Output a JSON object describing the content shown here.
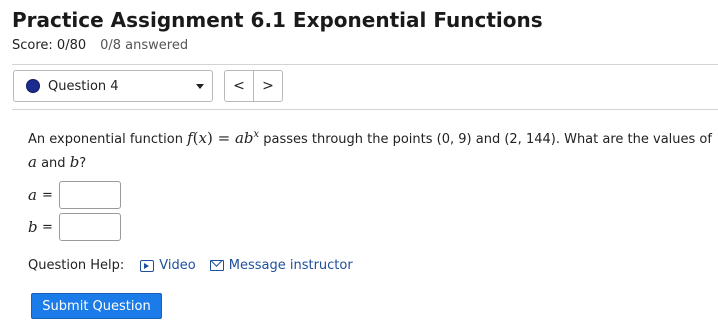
{
  "assignment": {
    "title": "Practice Assignment 6.1 Exponential Functions",
    "score": "Score: 0/80",
    "answered": "0/8 answered"
  },
  "question_nav": {
    "selected": "Question 4",
    "prev_symbol": "<",
    "next_symbol": ">"
  },
  "question": {
    "intro": "An exponential function ",
    "func_f": "f",
    "func_x": "x",
    "func_eq": " = ",
    "func_ab": "ab",
    "func_exp": "x",
    "mid": " passes through the points (0, 9) and (2, 144). What are the values of ",
    "var_a": "a",
    "and_text": " and ",
    "var_b": "b",
    "end": "?"
  },
  "answers": {
    "a_label": "a",
    "b_label": "b",
    "eq": "=",
    "a_value": "",
    "b_value": ""
  },
  "help": {
    "label": "Question Help:",
    "video": "Video",
    "message": "Message instructor"
  },
  "submit_label": "Submit Question",
  "colors": {
    "accent": "#1b7be8",
    "link": "#1f4f9c",
    "status_dot": "#1c2c8c"
  }
}
